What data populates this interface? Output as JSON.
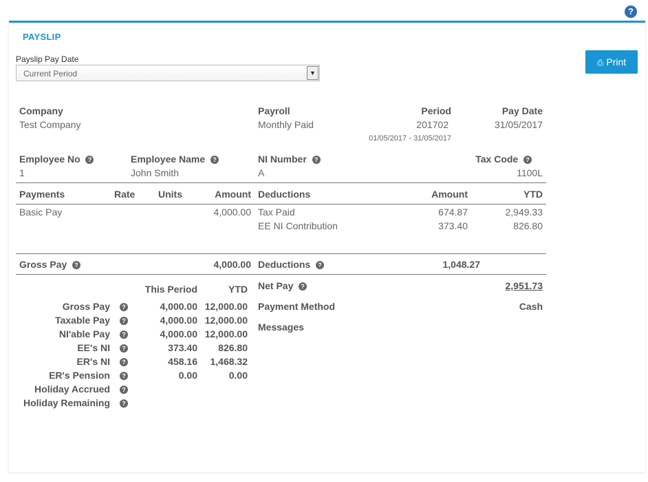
{
  "help_icon": "question-circle-icon",
  "title": "PAYSLIP",
  "pay_date": {
    "label": "Payslip Pay Date",
    "value": "Current Period"
  },
  "print_label": "Print",
  "header": {
    "company_label": "Company",
    "company": "Test Company",
    "payroll_label": "Payroll",
    "payroll": "Monthly Paid",
    "period_label": "Period",
    "period": "201702",
    "period_range": "01/05/2017 - 31/05/2017",
    "pay_date_label": "Pay Date",
    "pay_date": "31/05/2017"
  },
  "employee": {
    "no_label": "Employee No",
    "no": "1",
    "name_label": "Employee Name",
    "name": "John Smith",
    "ni_label": "NI Number",
    "ni": "A",
    "tax_label": "Tax Code",
    "tax": "1100L"
  },
  "payments": {
    "headers": {
      "payments": "Payments",
      "rate": "Rate",
      "units": "Units",
      "amount": "Amount"
    },
    "rows": [
      {
        "name": "Basic Pay",
        "rate": "",
        "units": "",
        "amount": "4,000.00"
      }
    ]
  },
  "deductions": {
    "headers": {
      "deductions": "Deductions",
      "amount": "Amount",
      "ytd": "YTD"
    },
    "rows": [
      {
        "name": "Tax Paid",
        "amount": "674.87",
        "ytd": "2,949.33"
      },
      {
        "name": "EE NI Contribution",
        "amount": "373.40",
        "ytd": "826.80"
      }
    ]
  },
  "totals": {
    "gross_label": "Gross Pay",
    "gross": "4,000.00",
    "deductions_label": "Deductions",
    "deductions": "1,048.27"
  },
  "summary": {
    "this_period_label": "This Period",
    "ytd_label": "YTD",
    "rows": [
      {
        "label": "Gross Pay",
        "this": "4,000.00",
        "ytd": "12,000.00"
      },
      {
        "label": "Taxable Pay",
        "this": "4,000.00",
        "ytd": "12,000.00"
      },
      {
        "label": "NI'able Pay",
        "this": "4,000.00",
        "ytd": "12,000.00"
      },
      {
        "label": "EE's NI",
        "this": "373.40",
        "ytd": "826.80"
      },
      {
        "label": "ER's NI",
        "this": "458.16",
        "ytd": "1,468.32"
      },
      {
        "label": "ER's Pension",
        "this": "0.00",
        "ytd": "0.00"
      },
      {
        "label": "Holiday Accrued",
        "this": "",
        "ytd": ""
      },
      {
        "label": "Holiday Remaining",
        "this": "",
        "ytd": ""
      }
    ]
  },
  "net": {
    "net_label": "Net Pay",
    "net": "2,951.73",
    "method_label": "Payment Method",
    "method": "Cash",
    "messages_label": "Messages"
  }
}
